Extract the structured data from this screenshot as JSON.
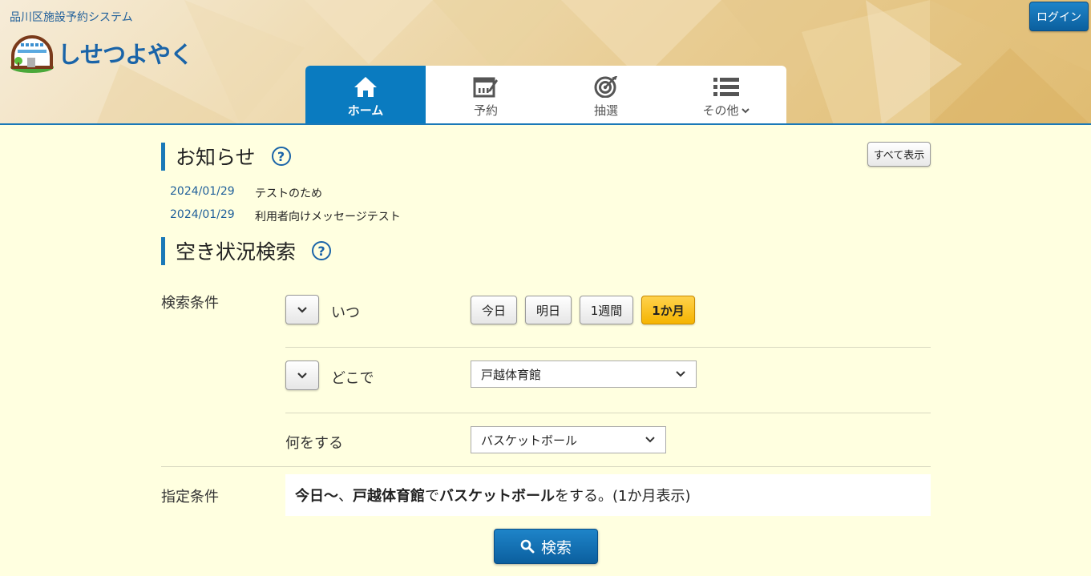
{
  "header": {
    "system_name": "品川区施設予約システム",
    "logo_text": "しせつよやく",
    "login_label": "ログイン"
  },
  "nav": {
    "tabs": [
      {
        "label": "ホーム",
        "icon": "home-icon",
        "active": true
      },
      {
        "label": "予約",
        "icon": "reservation-icon",
        "active": false
      },
      {
        "label": "抽選",
        "icon": "lottery-target-icon",
        "active": false
      },
      {
        "label": "その他",
        "icon": "list-icon",
        "active": false
      }
    ]
  },
  "notices": {
    "title": "お知らせ",
    "show_all_label": "すべて表示",
    "items": [
      {
        "date": "2024/01/29",
        "text": "テストのため"
      },
      {
        "date": "2024/01/29",
        "text": "利用者向けメッセージテスト"
      }
    ]
  },
  "search": {
    "title": "空き状況検索",
    "conditions_label": "検索条件",
    "when_label": "いつ",
    "when_options": [
      {
        "label": "今日",
        "active": false
      },
      {
        "label": "明日",
        "active": false
      },
      {
        "label": "1週間",
        "active": false
      },
      {
        "label": "1か月",
        "active": true
      }
    ],
    "where_label": "どこで",
    "where_value": "戸越体育館",
    "what_label": "何をする",
    "what_value": "バスケットボール",
    "specified_label": "指定条件",
    "summary": {
      "part1": "今日〜",
      "part2": "、",
      "part3": "戸越体育館",
      "part4": "で",
      "part5": "バスケットボール",
      "part6": "をする。(1か月表示)"
    },
    "search_button_label": "検索"
  },
  "colors": {
    "primary": "#0a7bc0",
    "accent": "#f5b400",
    "background": "#ffffe0"
  }
}
